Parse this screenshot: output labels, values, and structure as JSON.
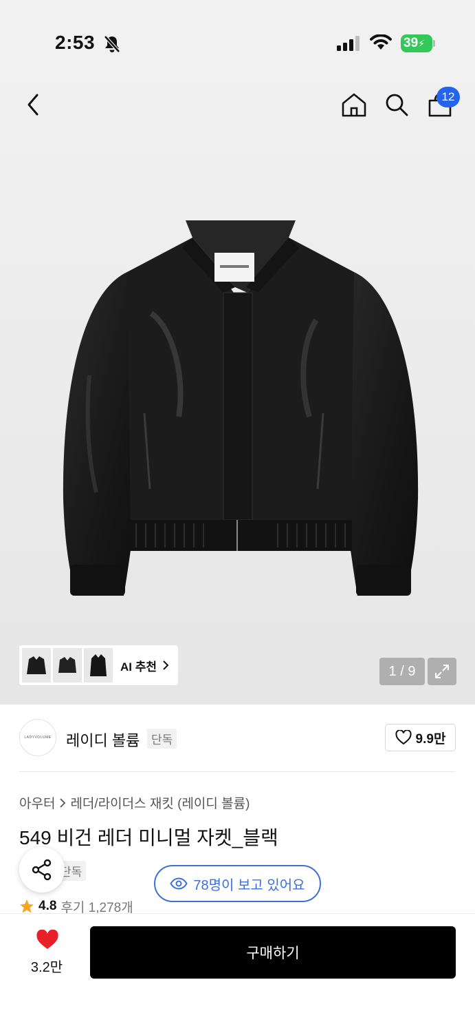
{
  "status_bar": {
    "time": "2:53",
    "battery": "39"
  },
  "nav": {
    "cart_count": "12"
  },
  "gallery": {
    "ai_label": "AI 추천",
    "pager": "1 / 9"
  },
  "brand": {
    "logo_text": "LADYVOLUME",
    "name": "레이디 볼륨",
    "exclusive": "단독",
    "likes": "9.9만"
  },
  "product": {
    "breadcrumb": [
      "아우터",
      "레더/라이더스 재킷 (레이디 볼륨)"
    ],
    "title": "549 비건 레더 미니멀 자켓_블랙",
    "exclusive": "단독",
    "viewers": "78명이 보고 있어요",
    "rating": "4.8",
    "reviews": "후기 1,278개"
  },
  "bottom": {
    "wish_count": "3.2만",
    "buy_label": "구매하기"
  },
  "colors": {
    "accent_blue": "#2563eb",
    "battery_green": "#34c759",
    "heart_red": "#e8202a"
  }
}
